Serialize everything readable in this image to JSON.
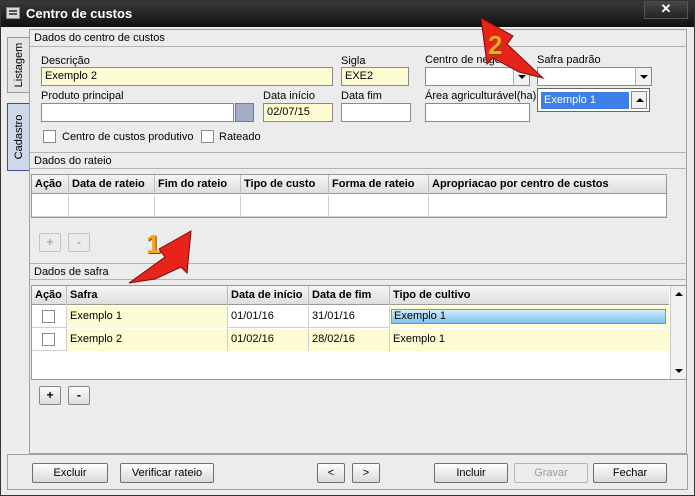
{
  "window": {
    "title": "Centro de custos",
    "close_label": "✕"
  },
  "side_tabs": [
    {
      "label": "Listagem"
    },
    {
      "label": "Cadastro"
    }
  ],
  "dados_centro": {
    "header": "Dados do centro de custos",
    "descricao": {
      "label": "Descrição",
      "value": "Exemplo 2"
    },
    "sigla": {
      "label": "Sigla",
      "value": "EXE2"
    },
    "centro_negocio": {
      "label": "Centro de negoc",
      "value": ""
    },
    "safra_padrao": {
      "label": "Safra padrão",
      "value": ""
    },
    "produto_principal": {
      "label": "Produto principal",
      "value": ""
    },
    "data_inicio": {
      "label": "Data início",
      "value": "02/07/15"
    },
    "data_fim": {
      "label": "Data fim",
      "value": ""
    },
    "area": {
      "label": "Área agriculturável(ha)",
      "value": ""
    },
    "checkbox_produtivo": {
      "label": "Centro de custos produtivo",
      "checked": false
    },
    "checkbox_rateado": {
      "label": "Rateado",
      "checked": false
    },
    "safra_dropdown_option": "Exemplo 1"
  },
  "dados_rateio": {
    "header": "Dados do rateio",
    "columns": [
      "Ação",
      "Data de rateio",
      "Fim do rateio",
      "Tipo de custo",
      "Forma de rateio",
      "Apropriacao por centro de custos"
    ],
    "add_label": "+",
    "remove_label": "-"
  },
  "dados_safra": {
    "header": "Dados de safra",
    "columns": [
      "Ação",
      "Safra",
      "Data de início",
      "Data de fim",
      "Tipo de cultivo"
    ],
    "rows": [
      {
        "safra": "Exemplo 1",
        "inicio": "01/01/16",
        "fim": "31/01/16",
        "cultivo": "Exemplo 1"
      },
      {
        "safra": "Exemplo 2",
        "inicio": "01/02/16",
        "fim": "28/02/16",
        "cultivo": "Exemplo 1"
      }
    ],
    "add_label": "+",
    "remove_label": "-"
  },
  "footer": {
    "excluir": "Excluir",
    "verificar": "Verificar rateio",
    "prev": "<",
    "next": ">",
    "incluir": "Incluir",
    "gravar": "Gravar",
    "fechar": "Fechar"
  },
  "annotations": [
    {
      "number": "1",
      "color": "#e8231a"
    },
    {
      "number": "2",
      "color": "#e8231a"
    }
  ]
}
